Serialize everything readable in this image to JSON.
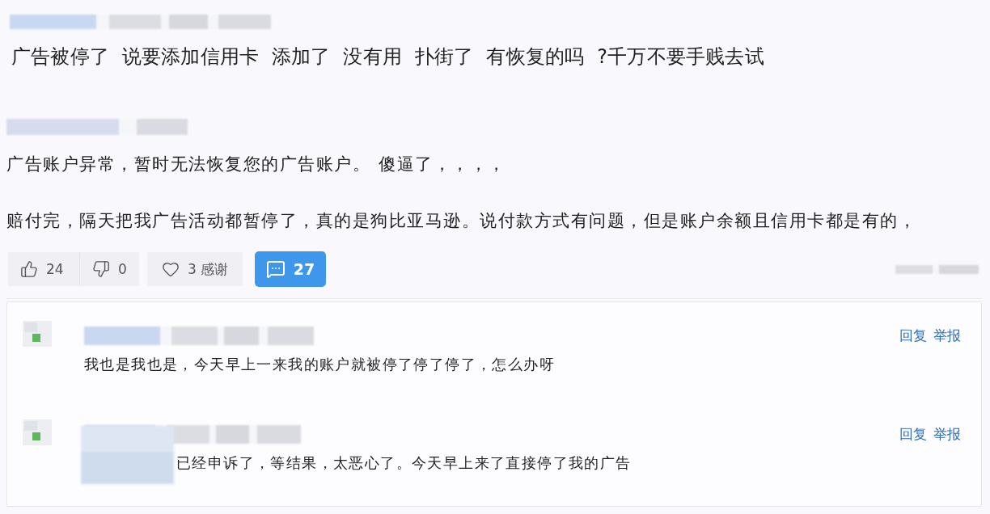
{
  "posts": [
    {
      "paragraphs": [
        "广告被停了 说要添加信用卡 添加了 没有用 扑街了 有恢复的吗 ?千万不要手贱去试"
      ]
    },
    {
      "paragraphs": [
        "广告账户异常，暂时无法恢复您的广告账户。 傻逼了，，，，",
        "赔付完，隔天把我广告活动都暂停了，真的是狗比亚马逊。说付款方式有问题，但是账户余额且信用卡都是有的，"
      ],
      "votes": [
        {
          "kind": "up",
          "count": "24"
        },
        {
          "kind": "down",
          "count": "0"
        }
      ],
      "thanks": {
        "count": "3",
        "label": "感谢"
      },
      "comments": {
        "count": "27",
        "expanded": true
      },
      "replies": [
        {
          "text": "我也是我也是，今天早上一来我的账户就被停了停了停了，怎么办呀",
          "obscured": false,
          "actions": [
            "回复",
            "举报"
          ]
        },
        {
          "text": "已经申诉了，等结果，太恶心了。今天早上来了直接停了我的广告",
          "obscured": true,
          "actions": [
            "回复",
            "举报"
          ]
        }
      ]
    }
  ]
}
